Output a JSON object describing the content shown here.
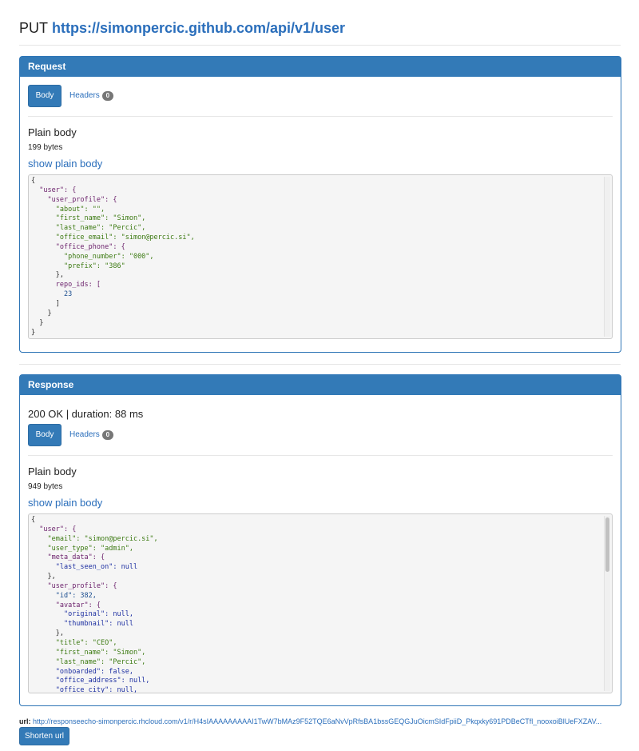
{
  "header": {
    "method": "PUT",
    "url": "https://simonpercic.github.com/api/v1/user"
  },
  "request": {
    "panel_title": "Request",
    "body_tab_label": "Body",
    "headers_tab_label": "Headers",
    "headers_count": "0",
    "plain_body_title": "Plain body",
    "bytes": "199 bytes",
    "show_link": "show plain body",
    "code_lines": [
      "{",
      "  \"user\": {",
      "    \"user_profile\": {",
      "      \"about\": \"\",",
      "      \"first_name\": \"Simon\",",
      "      \"last_name\": \"Percic\",",
      "      \"office_email\": \"simon@percic.si\",",
      "      \"office_phone\": {",
      "        \"phone_number\": \"000\",",
      "        \"prefix\": \"386\"",
      "      },",
      "      repo_ids: [",
      "        23",
      "      ]",
      "    }",
      "  }",
      "}"
    ]
  },
  "response": {
    "panel_title": "Response",
    "status_line": "200 OK | duration: 88 ms",
    "body_tab_label": "Body",
    "headers_tab_label": "Headers",
    "headers_count": "0",
    "plain_body_title": "Plain body",
    "bytes": "949 bytes",
    "show_link": "show plain body",
    "code_lines": [
      "{",
      "  \"user\": {",
      "    \"email\": \"simon@percic.si\",",
      "    \"user_type\": \"admin\",",
      "    \"meta_data\": {",
      "      \"last_seen_on\": null",
      "    },",
      "    \"user_profile\": {",
      "      \"id\": 382,",
      "      \"avatar\": {",
      "        \"original\": null,",
      "        \"thumbnail\": null",
      "      },",
      "      \"title\": \"CEO\",",
      "      \"first_name\": \"Simon\",",
      "      \"last_name\": \"Percic\",",
      "      \"onboarded\": false,",
      "      \"office_address\": null,",
      "      \"office_city\": null,"
    ]
  },
  "footer": {
    "url_label": "url:",
    "url": "http://responseecho-simonpercic.rhcloud.com/v1/r/H4sIAAAAAAAAAI1TwW7bMAz9F52TQE6aNvVpRfsBA1bssGEQGJuOicmSIdFpiiD_Pkqxky691PDBeCTfl_nooxoiBlUeFXZAV...",
    "shorten_label": "Shorten url"
  },
  "colors": {
    "primary": "#337ab7",
    "link": "#2a6ebb",
    "badge": "#777777",
    "code_bg": "#f5f5f5"
  }
}
